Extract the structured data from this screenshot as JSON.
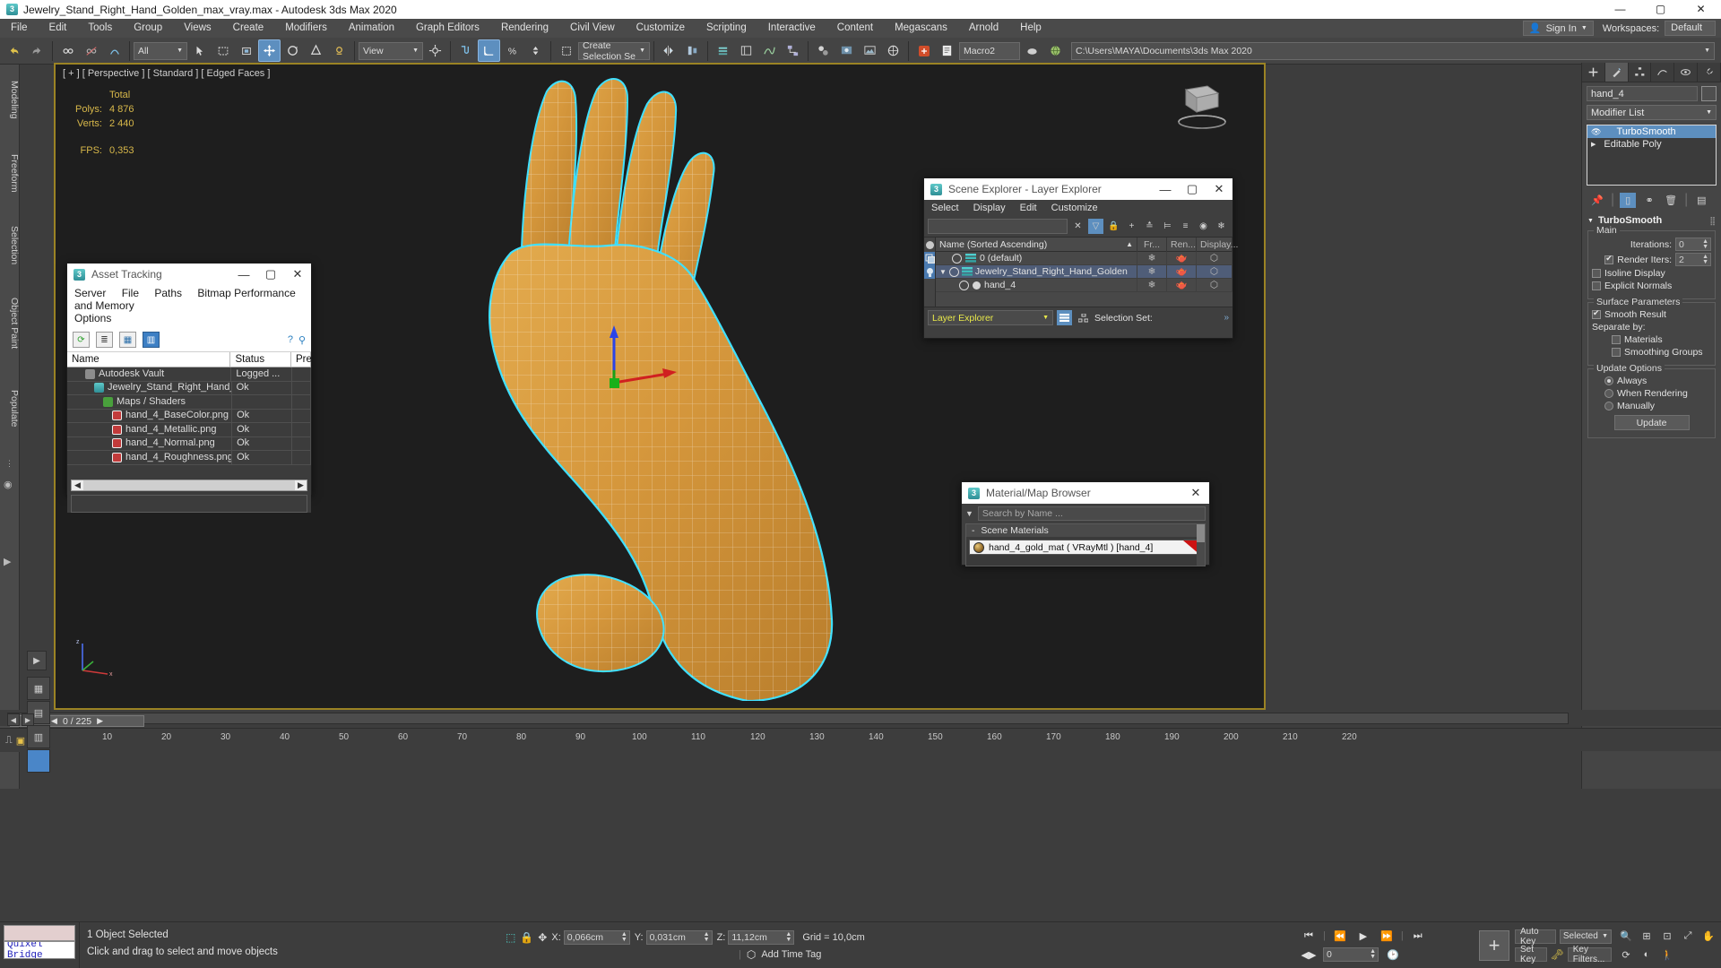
{
  "window": {
    "title": "Jewelry_Stand_Right_Hand_Golden_max_vray.max - Autodesk 3ds Max 2020",
    "minimize": "—",
    "maximize": "▢",
    "close": "✕",
    "app_icon": "3"
  },
  "menubar": {
    "items": [
      "File",
      "Edit",
      "Tools",
      "Group",
      "Views",
      "Create",
      "Modifiers",
      "Animation",
      "Graph Editors",
      "Rendering",
      "Civil View",
      "Customize",
      "Scripting",
      "Interactive",
      "Content",
      "Megascans",
      "Arnold",
      "Help"
    ],
    "signin": "Sign In",
    "workspaces_label": "Workspaces:",
    "workspace_value": "Default"
  },
  "toolbar": {
    "selection_filter": "All",
    "view_coord": "View",
    "named_selection_set": "Create Selection Se",
    "macro_label": "Macro2",
    "project_path": "C:\\Users\\MAYA\\Documents\\3ds Max 2020"
  },
  "left_ribbon": {
    "tabs": [
      "Modeling",
      "Freeform",
      "Selection",
      "Object Paint",
      "Populate"
    ]
  },
  "viewport": {
    "label": "[ + ] [ Perspective ] [ Standard ] [ Edged Faces ]",
    "stats_header": "Total",
    "stats": [
      {
        "label": "Polys:",
        "value": "4 876"
      },
      {
        "label": "Verts:",
        "value": "2 440"
      }
    ],
    "fps_label": "FPS:",
    "fps_value": "0,353"
  },
  "asset_tracking": {
    "title": "Asset Tracking",
    "menu": [
      "Server",
      "File",
      "Paths",
      "Bitmap Performance and Memory",
      "Options"
    ],
    "columns": [
      "Name",
      "Status",
      "Pre"
    ],
    "rows": [
      {
        "name": "Autodesk Vault",
        "status": "Logged ...",
        "indent": 1,
        "icon": "vault-icon"
      },
      {
        "name": "Jewelry_Stand_Right_Hand_Golde...",
        "status": "Ok",
        "indent": 2,
        "icon": "max-file-icon"
      },
      {
        "name": "Maps / Shaders",
        "status": "",
        "indent": 3,
        "icon": "maps-icon"
      },
      {
        "name": "hand_4_BaseColor.png",
        "status": "Ok",
        "indent": 4,
        "icon": "png-icon"
      },
      {
        "name": "hand_4_Metallic.png",
        "status": "Ok",
        "indent": 4,
        "icon": "png-icon"
      },
      {
        "name": "hand_4_Normal.png",
        "status": "Ok",
        "indent": 4,
        "icon": "png-icon"
      },
      {
        "name": "hand_4_Roughness.png",
        "status": "Ok",
        "indent": 4,
        "icon": "png-icon"
      }
    ]
  },
  "scene_explorer": {
    "title": "Scene Explorer - Layer Explorer",
    "menu": [
      "Select",
      "Display",
      "Edit",
      "Customize"
    ],
    "search_value": "",
    "columns": [
      "Name (Sorted Ascending)",
      "Fr...",
      "Ren...",
      "Display..."
    ],
    "sort_arrow": "▲",
    "rows": [
      {
        "name": "0 (default)",
        "selected": false,
        "expandable": false,
        "icon": "layer-icon"
      },
      {
        "name": "Jewelry_Stand_Right_Hand_Golden",
        "selected": true,
        "expandable": true,
        "icon": "layer-icon"
      },
      {
        "name": "hand_4",
        "selected": false,
        "expandable": false,
        "icon": "object-icon"
      }
    ],
    "footer_combo": "Layer Explorer",
    "selection_set_label": "Selection Set:"
  },
  "material_browser": {
    "title": "Material/Map Browser",
    "search_placeholder": "Search by Name ...",
    "group": "Scene Materials",
    "material": "hand_4_gold_mat  ( VRayMtl )  [hand_4]"
  },
  "command_panel": {
    "object_name": "hand_4",
    "modifier_list_label": "Modifier List",
    "stack": [
      {
        "label": "TurboSmooth",
        "selected": true
      },
      {
        "label": "Editable Poly",
        "selected": false
      }
    ],
    "rollup_title": "TurboSmooth",
    "main_group": "Main",
    "iterations_label": "Iterations:",
    "iterations_value": "0",
    "render_iters_label": "Render Iters:",
    "render_iters_value": "2",
    "render_iters_checked": true,
    "isoline_label": "Isoline Display",
    "explicit_label": "Explicit Normals",
    "surface_group": "Surface Parameters",
    "smooth_result_label": "Smooth Result",
    "separate_by_label": "Separate by:",
    "materials_label": "Materials",
    "smoothing_groups_label": "Smoothing Groups",
    "update_group": "Update Options",
    "update_options": [
      "Always",
      "When Rendering",
      "Manually"
    ],
    "update_selected": "Always",
    "update_button": "Update"
  },
  "timeline": {
    "slider_label": "0 / 225",
    "ticks": [
      "10",
      "20",
      "30",
      "40",
      "50",
      "60",
      "70",
      "80",
      "90",
      "100",
      "110",
      "120",
      "130",
      "140",
      "150",
      "160",
      "170",
      "180",
      "190",
      "200",
      "210",
      "220"
    ]
  },
  "statusbar": {
    "maxscript_mini_listener": "",
    "quixel_text": "Quixel Bridge",
    "objects_selected": "1 Object Selected",
    "prompt": "Click and drag to select and move objects",
    "coord_x_label": "X:",
    "coord_x": "0,066cm",
    "coord_y_label": "Y:",
    "coord_y": "0,031cm",
    "coord_z_label": "Z:",
    "coord_z": "11,12cm",
    "grid": "Grid = 10,0cm",
    "add_time_tag": "Add Time Tag",
    "frame_value": "0",
    "auto_key": "Auto Key",
    "set_key": "Set Key",
    "key_filters": "Key Filters...",
    "selected_combo": "Selected",
    "spinner_value": "0"
  },
  "colors": {
    "accent_blue": "#5d8fbf",
    "viewport_border": "#9b8324",
    "stats_yellow": "#d8b84a",
    "gold": "#d79a3c",
    "selection_cyan": "#44e0ff",
    "panel_bg": "#454545"
  }
}
